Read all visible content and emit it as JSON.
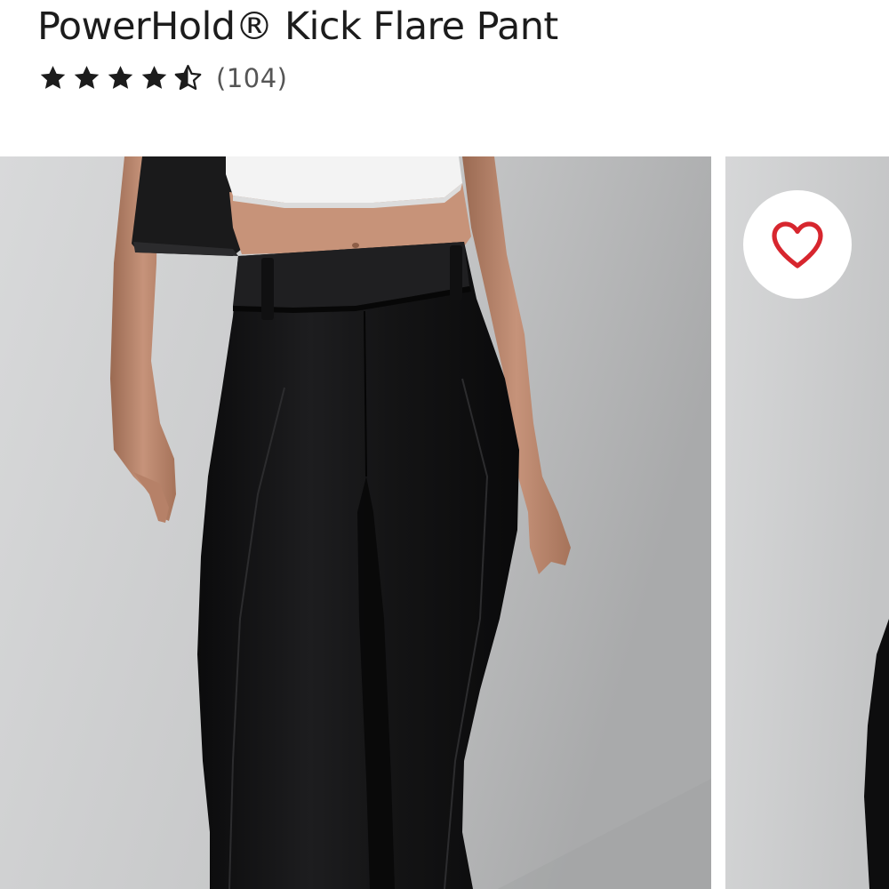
{
  "product": {
    "title": "PowerHold® Kick Flare Pant",
    "rating": 4.5,
    "rating_max": 5,
    "review_count_label": "(104)"
  },
  "gallery": {
    "images": [
      {
        "name": "model-front-view"
      },
      {
        "name": "model-side-view"
      }
    ]
  },
  "icons": {
    "star": "star-icon",
    "star_half": "star-half-icon",
    "favorite": "heart-outline-icon"
  },
  "colors": {
    "text": "#1c1c1c",
    "review_count": "#555555",
    "heart": "#d7262e",
    "star": "#1c1c1c",
    "photo_background": "#c9cacb"
  }
}
